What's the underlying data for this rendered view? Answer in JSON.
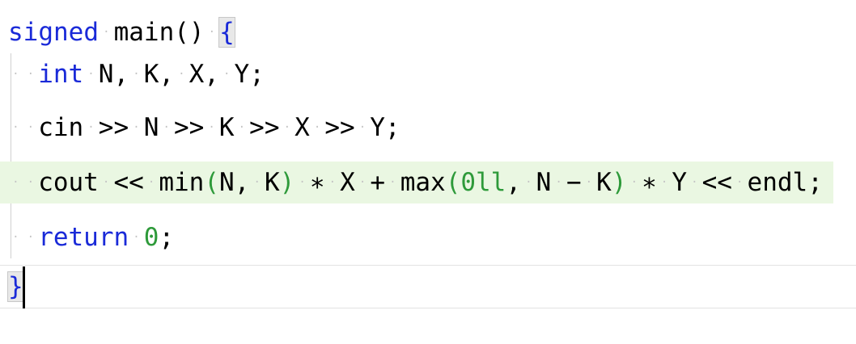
{
  "editor": {
    "lines": [
      "signed main() {",
      "  int N, K, X, Y;",
      "  cin >> N >> K >> X >> Y;",
      "  cout << min(N, K) * X + max(0ll, N - K) * Y << endl;",
      "  return 0;",
      "}"
    ],
    "highlighted_line": 4,
    "current_line": 6,
    "colors": {
      "keyword": "#1a2ad8",
      "literal": "#2e9a3a",
      "highlight_bg": "#eaf7e2"
    }
  }
}
